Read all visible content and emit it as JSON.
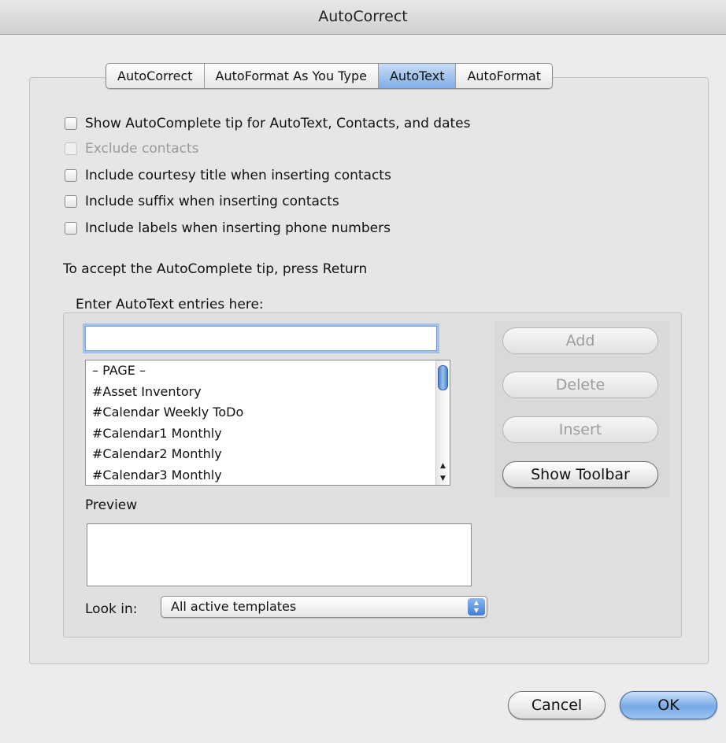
{
  "window": {
    "title": "AutoCorrect"
  },
  "tabs": [
    {
      "label": "AutoCorrect",
      "active": false
    },
    {
      "label": "AutoFormat As You Type",
      "active": false
    },
    {
      "label": "AutoText",
      "active": true
    },
    {
      "label": "AutoFormat",
      "active": false
    }
  ],
  "options": [
    {
      "label": "Show AutoComplete tip for AutoText, Contacts, and dates",
      "checked": false,
      "enabled": true
    },
    {
      "label": "Exclude contacts",
      "checked": false,
      "enabled": false
    },
    {
      "label": "Include courtesy title when inserting contacts",
      "checked": false,
      "enabled": true
    },
    {
      "label": "Include suffix when inserting contacts",
      "checked": false,
      "enabled": true
    },
    {
      "label": "Include labels when inserting phone numbers",
      "checked": false,
      "enabled": true
    }
  ],
  "hint_text": "To accept the AutoComplete tip, press Return",
  "entries": {
    "label": "Enter AutoText entries here:",
    "input_value": "",
    "list": [
      "– PAGE –",
      "#Asset Inventory",
      "#Calendar Weekly ToDo",
      "#Calendar1 Monthly",
      "#Calendar2 Monthly",
      "#Calendar3 Monthly"
    ]
  },
  "buttons": {
    "add": "Add",
    "delete": "Delete",
    "insert": "Insert",
    "show_toolbar": "Show Toolbar"
  },
  "preview": {
    "label": "Preview",
    "content": ""
  },
  "look_in": {
    "label": "Look in:",
    "selected": "All active templates"
  },
  "dialog_buttons": {
    "cancel": "Cancel",
    "ok": "OK"
  },
  "colors": {
    "accent": "#80aee6",
    "focus_ring": "#9ec1ef",
    "window_bg": "#ececec"
  }
}
